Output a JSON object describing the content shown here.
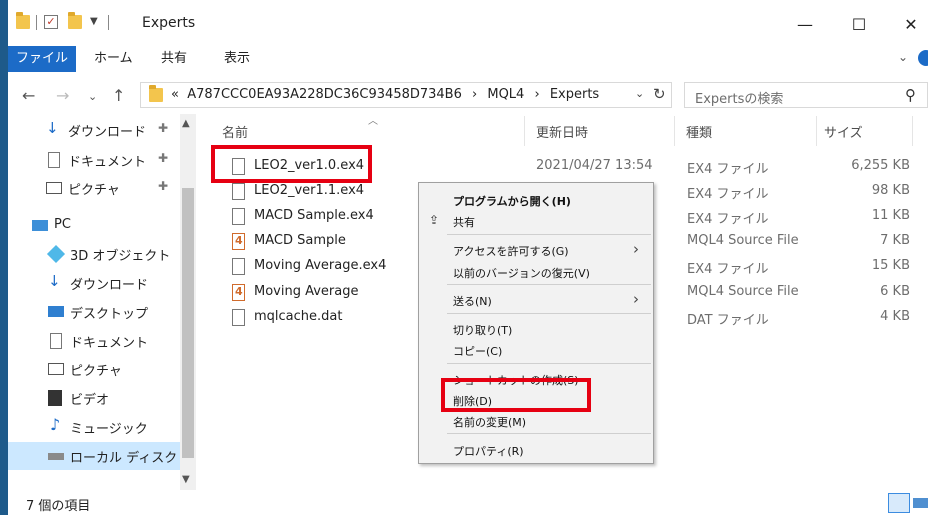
{
  "window": {
    "title": "Experts",
    "controls": {
      "minimize": "—",
      "maximize": "☐",
      "close": "✕"
    }
  },
  "ribbon": {
    "tabs": [
      "ファイル",
      "ホーム",
      "共有",
      "表示"
    ]
  },
  "address": {
    "prefix": "«",
    "segments": [
      "A787CCC0EA93A228DC36C93458D734B6",
      "MQL4",
      "Experts"
    ],
    "separator": "›"
  },
  "search": {
    "placeholder": "Expertsの検索"
  },
  "sidebar": {
    "items": [
      {
        "label": "ダウンロード",
        "icon": "download-icon",
        "pinned": true
      },
      {
        "label": "ドキュメント",
        "icon": "document-icon",
        "pinned": true
      },
      {
        "label": "ピクチャ",
        "icon": "pictures-icon",
        "pinned": true
      },
      {
        "label": "PC",
        "icon": "pc-icon",
        "pinned": false
      },
      {
        "label": "3D オブジェクト",
        "icon": "3d-objects-icon",
        "pinned": false
      },
      {
        "label": "ダウンロード",
        "icon": "download-icon",
        "pinned": false
      },
      {
        "label": "デスクトップ",
        "icon": "desktop-icon",
        "pinned": false
      },
      {
        "label": "ドキュメント",
        "icon": "document-icon",
        "pinned": false
      },
      {
        "label": "ピクチャ",
        "icon": "pictures-icon",
        "pinned": false
      },
      {
        "label": "ビデオ",
        "icon": "video-icon",
        "pinned": false
      },
      {
        "label": "ミュージック",
        "icon": "music-icon",
        "pinned": false
      },
      {
        "label": "ローカル ディスク (C",
        "icon": "local-disk-icon",
        "pinned": false
      }
    ]
  },
  "columns": {
    "name": "名前",
    "date": "更新日時",
    "type": "種類",
    "size": "サイズ"
  },
  "files": [
    {
      "name": "LEO2_ver1.0.ex4",
      "date": "2021/04/27 13:54",
      "type": "EX4 ファイル",
      "size": "6,255 KB",
      "kind": "file"
    },
    {
      "name": "LEO2_ver1.1.ex4",
      "date": "",
      "type": "EX4 ファイル",
      "size": "98 KB",
      "kind": "file"
    },
    {
      "name": "MACD Sample.ex4",
      "date": "",
      "type": "EX4 ファイル",
      "size": "11 KB",
      "kind": "file"
    },
    {
      "name": "MACD Sample",
      "date": "",
      "type": "MQL4 Source File",
      "size": "7 KB",
      "kind": "mql"
    },
    {
      "name": "Moving Average.ex4",
      "date": "",
      "type": "EX4 ファイル",
      "size": "15 KB",
      "kind": "file"
    },
    {
      "name": "Moving Average",
      "date": "",
      "type": "MQL4 Source File",
      "size": "6 KB",
      "kind": "mql"
    },
    {
      "name": "mqlcache.dat",
      "date": "",
      "type": "DAT ファイル",
      "size": "4 KB",
      "kind": "file"
    }
  ],
  "context_menu": {
    "open_with": "プログラムから開く(H)",
    "share": "共有",
    "give_access": "アクセスを許可する(G)",
    "restore_previous": "以前のバージョンの復元(V)",
    "send_to": "送る(N)",
    "cut": "切り取り(T)",
    "copy": "コピー(C)",
    "create_shortcut": "ショートカットの作成(S)",
    "delete": "削除(D)",
    "rename": "名前の変更(M)",
    "properties": "プロパティ(R)"
  },
  "status": {
    "item_count": "7 個の項目"
  },
  "colors": {
    "accent": "#1c6bc7",
    "highlight": "#e60012",
    "selection": "#cce8ff"
  }
}
